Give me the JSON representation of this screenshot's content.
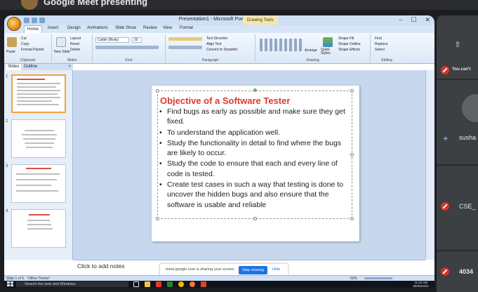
{
  "meet": {
    "top_title": "Google Meet presenting",
    "sharing_text": "meet.google.com is sharing your screen.",
    "stop_sharing": "Stop sharing",
    "hide": "Hide"
  },
  "window": {
    "title": "Presentation1 - Microsoft PowerPoint",
    "context_tab": "Drawing Tools",
    "min": "–",
    "max": "☐",
    "close": "✕"
  },
  "ribbon": {
    "tabs": [
      "Home",
      "Insert",
      "Design",
      "Animations",
      "Slide Show",
      "Review",
      "View",
      "Format"
    ],
    "groups": [
      "Clipboard",
      "Slides",
      "Font",
      "Paragraph",
      "Drawing",
      "Editing"
    ],
    "clipboard": {
      "paste": "Paste",
      "cut": "Cut",
      "copy": "Copy",
      "format_painter": "Format Painter"
    },
    "slides": {
      "new_slide": "New Slide",
      "layout": "Layout",
      "reset": "Reset",
      "delete": "Delete"
    },
    "font": {
      "name": "Calibri (Body)",
      "size": "20"
    },
    "paragraph": {
      "text_direction": "Text Direction",
      "align_text": "Align Text",
      "smartart": "Convert to SmartArt"
    },
    "drawing": {
      "arrange": "Arrange",
      "quick_styles": "Quick Styles",
      "shape_fill": "Shape Fill",
      "shape_outline": "Shape Outline",
      "shape_effects": "Shape Effects"
    },
    "editing": {
      "find": "Find",
      "replace": "Replace",
      "select": "Select"
    }
  },
  "slides_pane": {
    "tab_slides": "Slides",
    "tab_outline": "Outline",
    "close": "×",
    "thumb_numbers": [
      "1",
      "2",
      "3",
      "4"
    ]
  },
  "slide": {
    "title": "Objective of a Software Tester",
    "bullets": [
      "Find bugs as early as possible and make sure they get fixed.",
      "To understand the application well.",
      "Study the functionality in detail to find where the bugs are likely to occur.",
      "Study the code to ensure that each and every line of code is tested.",
      "Create test cases in such a way that testing is done to uncover the hidden bugs and also ensure that the software is usable and reliable"
    ]
  },
  "notes": {
    "placeholder": "Click to add notes"
  },
  "statusbar": {
    "slide_info": "Slide 1 of 5",
    "theme": "\"Office Theme\"",
    "zoom": "60%"
  },
  "taskbar": {
    "search_placeholder": "Search the web and Windows",
    "time": "11:26 AM",
    "date": "06/05/2021"
  },
  "participants": {
    "cant_text": "You can't",
    "names": [
      "susha",
      "CSE_",
      "4034"
    ]
  },
  "colors": {
    "slide_title": "#e23828",
    "stop_sharing": "#1a73e8",
    "mic_off": "#d93025",
    "thumb_selected": "#f2a33a"
  }
}
